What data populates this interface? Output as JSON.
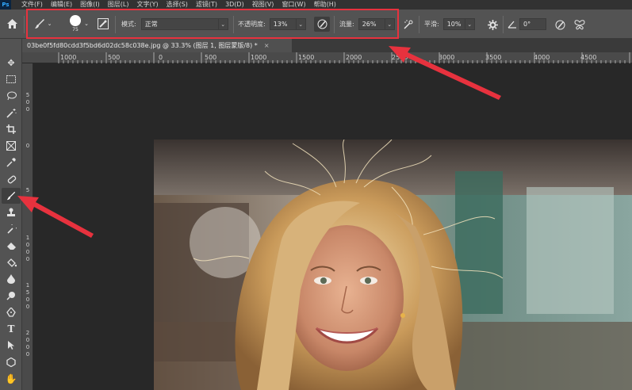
{
  "menu": {
    "logo": "Ps",
    "items": [
      "文件(F)",
      "编辑(E)",
      "图像(I)",
      "图层(L)",
      "文字(Y)",
      "选择(S)",
      "滤镜(T)",
      "3D(D)",
      "视图(V)",
      "窗口(W)",
      "帮助(H)"
    ]
  },
  "options": {
    "brush_size": "75",
    "mode_label": "模式:",
    "mode_value": "正常",
    "opacity_label": "不透明度:",
    "opacity_value": "13%",
    "flow_label": "流量:",
    "flow_value": "26%",
    "smoothing_label": "平滑:",
    "smoothing_value": "10%",
    "angle_value": "0°"
  },
  "document": {
    "tab_title": "03be0f5fd80cdd3f5bd6d02dc58c038e.jpg @ 33.3% (图层 1, 图层蒙版/8) *",
    "close_glyph": "×"
  },
  "ruler": {
    "h_labels": [
      "1000",
      "500",
      "0",
      "500",
      "1000",
      "1500",
      "2000",
      "2500",
      "3000",
      "3500",
      "4000",
      "4500"
    ],
    "v_labels": [
      "5\n0\n0",
      "0",
      "5",
      "1\n0\n0\n0",
      "1\n5\n0\n0",
      "2\n0\n0\n0"
    ]
  },
  "icons": {
    "home": "home-icon",
    "brush": "brush-icon"
  },
  "colors": {
    "highlight": "#e7323e",
    "arrow": "#e7323e"
  }
}
